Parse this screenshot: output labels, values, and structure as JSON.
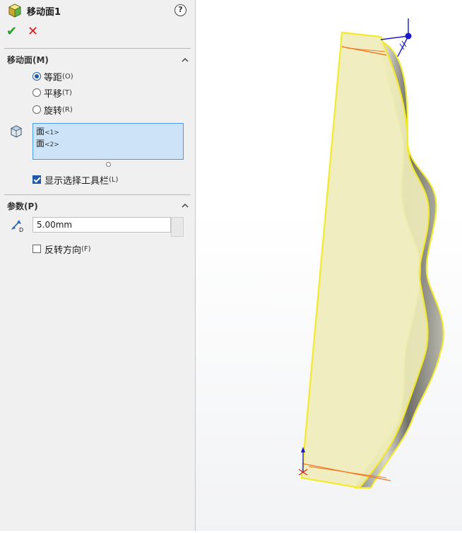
{
  "feature": {
    "title": "移动面1"
  },
  "icons": {
    "feature": "move-face-feature-icon",
    "help": "help-icon",
    "ok": "checkmark-icon",
    "cancel": "close-icon",
    "collapse": "chevron-up-icon",
    "face": "face-icon",
    "distance": "distance-icon"
  },
  "move_face_section": {
    "title": "移动面(M)",
    "options": [
      {
        "label": "等距",
        "hotkey": "(O)",
        "selected": true
      },
      {
        "label": "平移",
        "hotkey": "(T)",
        "selected": false
      },
      {
        "label": "旋转",
        "hotkey": "(R)",
        "selected": false
      }
    ],
    "selection": [
      {
        "name": "面",
        "index": "<1>"
      },
      {
        "name": "面",
        "index": "<2>"
      }
    ],
    "show_toolbar": {
      "label": "显示选择工具栏",
      "hotkey": "(L)",
      "checked": true
    }
  },
  "params_section": {
    "title": "参数(P)",
    "distance_value": "5.00mm",
    "reverse": {
      "label": "反转方向",
      "hotkey": "(F)",
      "checked": false
    }
  },
  "colors": {
    "accent": "#1e5aa8",
    "ok": "#1fa51f",
    "cancel": "#d22020",
    "selected_face": "#efecbb",
    "edge_highlight": "#f2ea2a",
    "direction_arrow": "#f07a28",
    "triad": "#1a1acc"
  }
}
